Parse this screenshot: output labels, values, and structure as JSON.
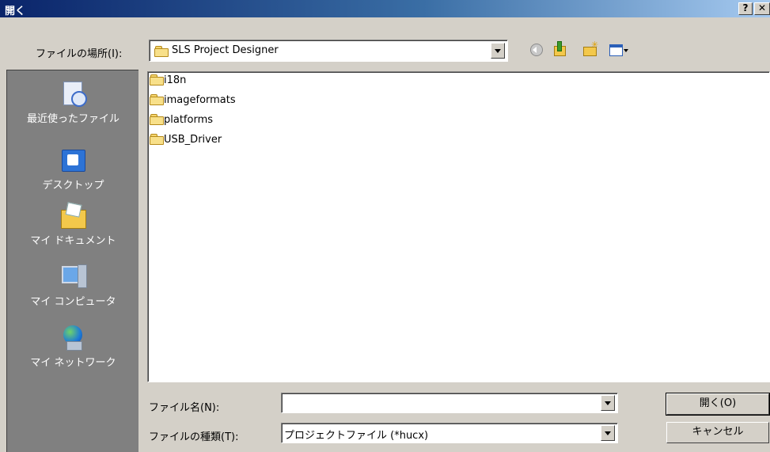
{
  "window": {
    "title": "開く",
    "help_glyph": "?",
    "close_glyph": "✕"
  },
  "lookin": {
    "label": "ファイルの場所(I):",
    "value": "SLS Project Designer"
  },
  "toolbar": {
    "icons": [
      "back-icon",
      "up-folder-icon",
      "new-folder-icon",
      "views-menu-icon"
    ]
  },
  "places": [
    {
      "label": "最近使ったファイル",
      "icon": "recent-documents-icon"
    },
    {
      "label": "デスクトップ",
      "icon": "desktop-icon"
    },
    {
      "label": "マイ ドキュメント",
      "icon": "my-documents-icon"
    },
    {
      "label": "マイ コンピュータ",
      "icon": "my-computer-icon"
    },
    {
      "label": "マイ ネットワーク",
      "icon": "my-network-icon"
    }
  ],
  "files": [
    {
      "name": "i18n",
      "icon": "folder-icon"
    },
    {
      "name": "imageformats",
      "icon": "folder-icon"
    },
    {
      "name": "platforms",
      "icon": "folder-icon"
    },
    {
      "name": "USB_Driver",
      "icon": "folder-icon"
    }
  ],
  "filename": {
    "label": "ファイル名(N):",
    "value": ""
  },
  "filetype": {
    "label": "ファイルの種類(T):",
    "value": "プロジェクトファイル (*hucx)"
  },
  "buttons": {
    "open": "開く(O)",
    "cancel": "キャンセル"
  }
}
